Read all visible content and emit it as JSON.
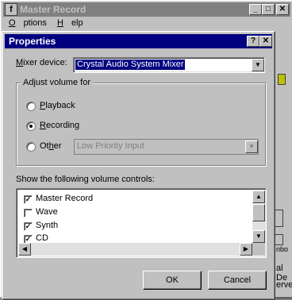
{
  "background_window": {
    "title": "Master Record",
    "menu": [
      "Options",
      "Help"
    ],
    "partial_texts": [
      "nbo",
      "al De",
      "erve"
    ]
  },
  "dialog": {
    "title": "Properties",
    "mixer_device_label": "Mixer device:",
    "mixer_device_value": "Crystal Audio System Mixer",
    "adjust_group_label": "Adjust volume for",
    "radios": [
      {
        "label": "Playback",
        "checked": false
      },
      {
        "label": "Recording",
        "checked": true
      },
      {
        "label": "Other",
        "checked": false
      }
    ],
    "other_select_value": "Low Priority Input",
    "controls_label": "Show the following volume controls:",
    "controls": [
      {
        "label": "Master Record",
        "checked": true
      },
      {
        "label": "Wave",
        "checked": false
      },
      {
        "label": "Synth",
        "checked": true
      },
      {
        "label": "CD",
        "checked": true
      }
    ],
    "ok_label": "OK",
    "cancel_label": "Cancel"
  },
  "colors": {
    "active_title": "#000080",
    "inactive_title": "#808080",
    "face": "#c0c0c0"
  }
}
